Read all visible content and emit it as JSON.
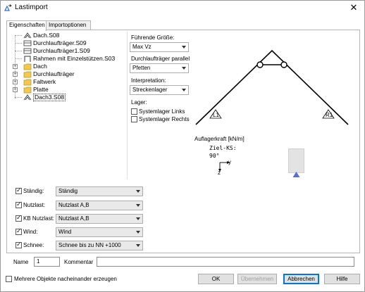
{
  "window": {
    "title": "Lastimport",
    "close_glyph": "✕"
  },
  "tabs": [
    {
      "label": "Eigenschaften",
      "active": true
    },
    {
      "label": "Importoptionen",
      "active": false
    }
  ],
  "tree": {
    "items": [
      {
        "label": "Dach.S08",
        "icon": "structure-icon"
      },
      {
        "label": "Durchlaufträger.S09",
        "icon": "beam-icon"
      },
      {
        "label": "Durchlaufträger1.S09",
        "icon": "beam-icon"
      },
      {
        "label": "Rahmen mit Einzelstützen.S03",
        "icon": "frame-icon"
      },
      {
        "label": "Dach",
        "icon": "folder-icon"
      },
      {
        "label": "Durchlaufträger",
        "icon": "folder-icon"
      },
      {
        "label": "Faltwerk",
        "icon": "folder-icon"
      },
      {
        "label": "Platte",
        "icon": "folder-icon"
      },
      {
        "label": "Dach3.S08",
        "icon": "structure-icon"
      }
    ]
  },
  "options": {
    "fuehrende_label": "Führende Größe:",
    "fuehrende_value": "Max Vz",
    "parallel_label": "Durchlaufträger parallel",
    "parallel_value": "Pfetten",
    "interpretation_label": "Interpretation:",
    "interpretation_value": "Streckenlager",
    "lager_label": "Lager:",
    "lager_links": "Systemlager Links",
    "lager_rechts": "Systemlager Rechts"
  },
  "drawing": {
    "support_left": "L1",
    "support_right": "R1",
    "auflagerkraft_label": "Auflagerkraft [kN/m]",
    "ziel_ks_label": "Ziel-KS:",
    "angle_label": "90°",
    "axis_y": "y",
    "axis_z": "z"
  },
  "loads": [
    {
      "label": "Ständig:",
      "value": "Ständig",
      "checked": true
    },
    {
      "label": "Nutzlast:",
      "value": "Nutzlast A,B",
      "checked": true
    },
    {
      "label": "KB Nutzlast:",
      "value": "Nutzlast A,B",
      "checked": true
    },
    {
      "label": "Wind:",
      "value": "Wind",
      "checked": true
    },
    {
      "label": "Schnee:",
      "value": "Schnee bis zu NN +1000",
      "checked": true
    }
  ],
  "name_field": {
    "label": "Name",
    "value": "1"
  },
  "kommentar_field": {
    "label": "Kommentar",
    "value": ""
  },
  "footer": {
    "mehrere_label": "Mehrere Objekte nacheinander erzeugen",
    "ok": "OK",
    "uebernehmen": "Übernehmen",
    "abbrechen": "Abbrechen",
    "hilfe": "Hilfe"
  },
  "colors": {
    "accent": "#0078d7",
    "folder": "#f2c94c",
    "support_marker": "#5a6fd6"
  }
}
